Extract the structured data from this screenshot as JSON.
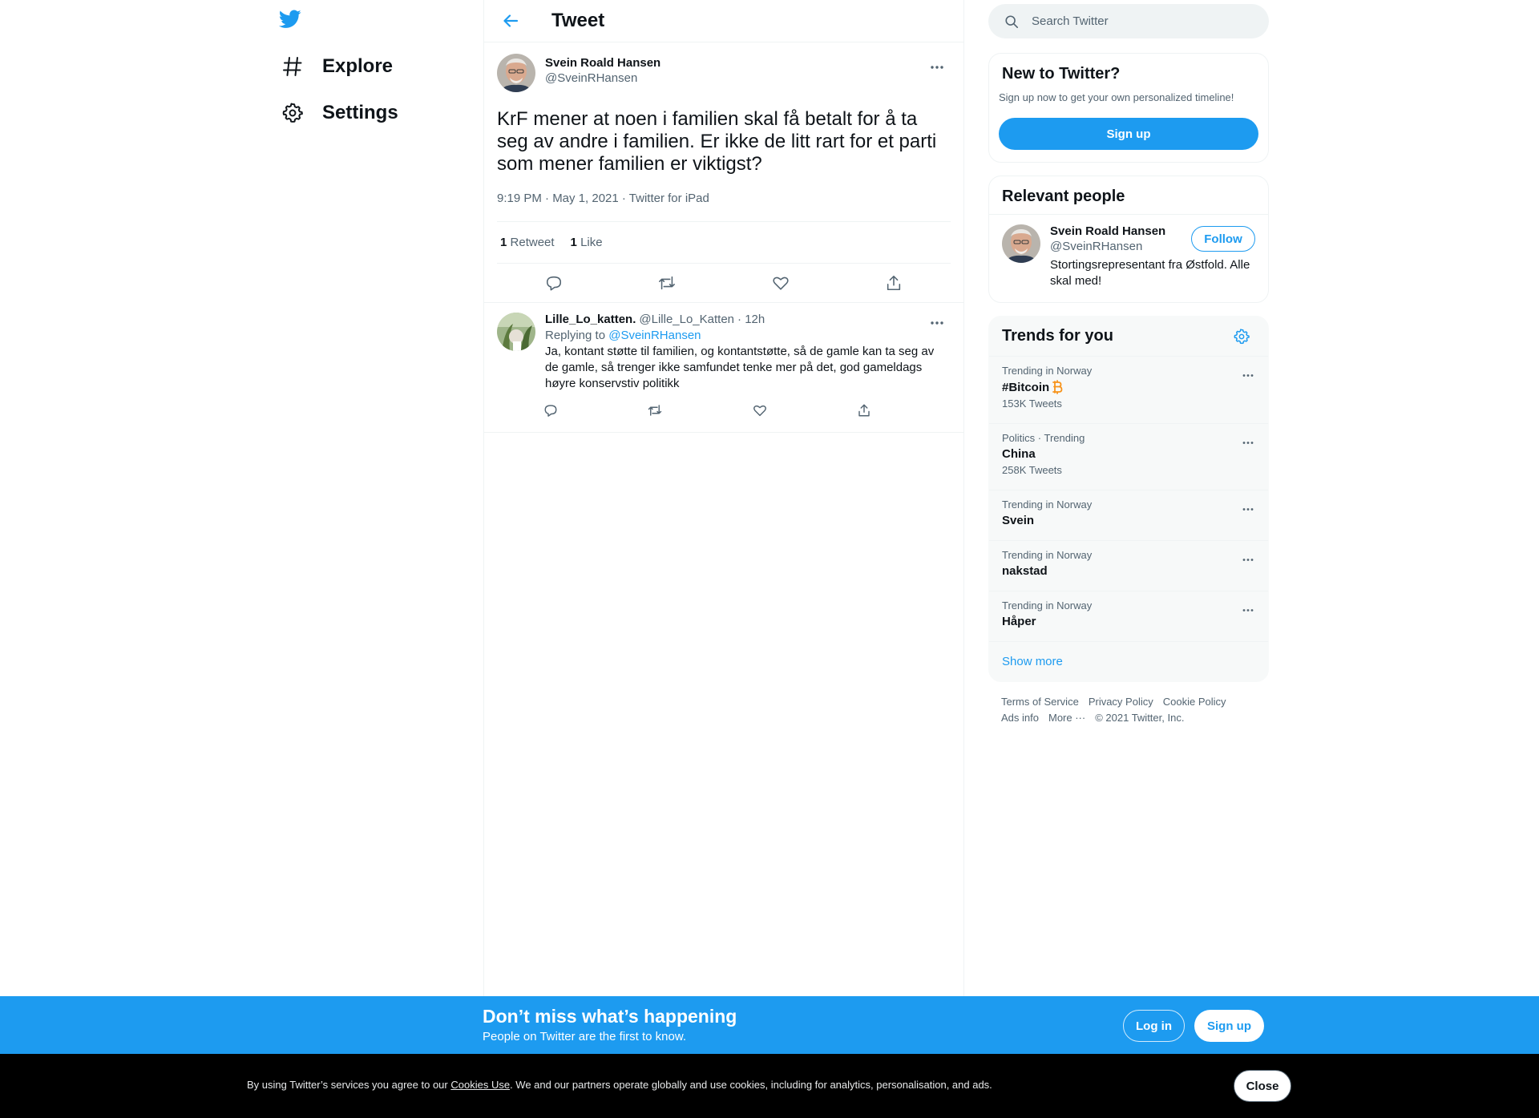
{
  "colors": {
    "accent": "#1d9bf0",
    "text": "#0f1419",
    "muted": "#536471",
    "bitcoin": "#f7931a"
  },
  "nav": {
    "items": [
      {
        "label": "Explore",
        "icon": "hashtag-icon"
      },
      {
        "label": "Settings",
        "icon": "gear-icon"
      }
    ]
  },
  "header": {
    "title": "Tweet"
  },
  "tweet": {
    "name": "Svein Roald Hansen",
    "handle": "@SveinRHansen",
    "text": "KrF mener at noen i familien skal få betalt for å ta seg av andre i familien. Er ikke de litt rart for et parti som mener familien er viktigst?",
    "meta": "9:19 PM · May 1, 2021 · Twitter for iPad",
    "retweets_count": "1",
    "retweets_label": "Retweet",
    "likes_count": "1",
    "likes_label": "Like"
  },
  "reply": {
    "name": "Lille_Lo_katten.",
    "handle": "@Lille_Lo_Katten",
    "time": "· 12h",
    "replying_prefix": "Replying to",
    "replying_to": "@SveinRHansen",
    "text": "Ja, kontant støtte til familien, og kontantstøtte, så de gamle kan ta seg av de gamle, så trenger ikke samfundet tenke mer på det, god gameldags høyre konservstiv politikk"
  },
  "search": {
    "placeholder": "Search Twitter"
  },
  "new_to_twitter": {
    "title": "New to Twitter?",
    "subtitle": "Sign up now to get your own personalized timeline!",
    "button": "Sign up"
  },
  "relevant_people": {
    "title": "Relevant people",
    "name": "Svein Roald Hansen",
    "handle": "@SveinRHansen",
    "bio": "Stortingsrepresentant fra Østfold. Alle skal med!",
    "follow": "Follow"
  },
  "trends": {
    "title": "Trends for you",
    "items": [
      {
        "context": "Trending in Norway",
        "name": "#Bitcoin",
        "count": "153K Tweets"
      },
      {
        "context": "Politics · Trending",
        "name": "China",
        "count": "258K Tweets"
      },
      {
        "context": "Trending in Norway",
        "name": "Svein",
        "count": ""
      },
      {
        "context": "Trending in Norway",
        "name": "nakstad",
        "count": ""
      },
      {
        "context": "Trending in Norway",
        "name": "Håper",
        "count": ""
      }
    ],
    "show_more": "Show more"
  },
  "footer": {
    "terms": "Terms of Service",
    "privacy": "Privacy Policy",
    "cookie": "Cookie Policy",
    "ads": "Ads info",
    "more": "More ···",
    "copyright": "© 2021 Twitter, Inc."
  },
  "promo": {
    "title": "Don’t miss what’s happening",
    "subtitle": "People on Twitter are the first to know.",
    "login": "Log in",
    "signup": "Sign up"
  },
  "cookie": {
    "prefix": "By using Twitter’s services you agree to our ",
    "link": "Cookies Use",
    "suffix": ". We and our partners operate globally and use cookies, including for analytics, personalisation, and ads.",
    "close": "Close"
  }
}
